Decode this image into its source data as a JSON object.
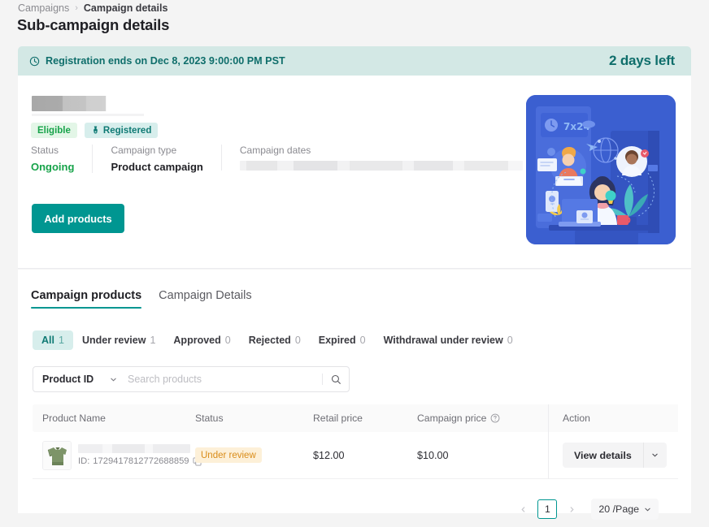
{
  "breadcrumb": {
    "parent": "Campaigns",
    "separator": "›",
    "current": "Campaign details"
  },
  "page_title": "Sub-campaign details",
  "banner": {
    "icon": "clock-icon",
    "message": "Registration ends on Dec 8, 2023 9:00:00 PM PST",
    "countdown": "2 days left",
    "bg_color": "#d3e8e5",
    "text_color": "#0f6e6b"
  },
  "summary": {
    "campaign_name_masked": true,
    "badges": [
      {
        "label": "Eligible",
        "color": "#17a34a",
        "bg": "#e3f6e7",
        "icon": null
      },
      {
        "label": "Registered",
        "color": "#0f7a74",
        "bg": "#d7eeec",
        "icon": "medal-icon"
      }
    ],
    "meta": [
      {
        "label": "Status",
        "value": "Ongoing",
        "highlight": "#17a34a"
      },
      {
        "label": "Campaign type",
        "value": "Product campaign",
        "highlight": null
      },
      {
        "label": "Campaign dates",
        "value": "",
        "masked": true
      }
    ],
    "add_products_label": "Add products",
    "add_products_color": "#009691",
    "illustration": {
      "name": "team-collaboration-illustration",
      "bg_color": "#3b5fd0",
      "screen_text": "7x24"
    }
  },
  "tabs": [
    {
      "label": "Campaign products",
      "active": true
    },
    {
      "label": "Campaign Details",
      "active": false
    }
  ],
  "status_filters": [
    {
      "label": "All",
      "count": "1",
      "active": true
    },
    {
      "label": "Under review",
      "count": "1",
      "active": false
    },
    {
      "label": "Approved",
      "count": "0",
      "active": false
    },
    {
      "label": "Rejected",
      "count": "0",
      "active": false
    },
    {
      "label": "Expired",
      "count": "0",
      "active": false
    },
    {
      "label": "Withdrawal under review",
      "count": "0",
      "active": false
    }
  ],
  "search": {
    "field_selected": "Product ID",
    "placeholder": "Search products",
    "icon": "search-icon"
  },
  "table": {
    "columns": [
      {
        "key": "name",
        "label": "Product Name"
      },
      {
        "key": "status",
        "label": "Status"
      },
      {
        "key": "retail",
        "label": "Retail price"
      },
      {
        "key": "campaign",
        "label": "Campaign price",
        "help_icon": "question-circle-icon"
      },
      {
        "key": "action",
        "label": "Action"
      }
    ],
    "rows": [
      {
        "thumbnail": "green-tshirt-thumbnail",
        "name_masked": true,
        "id_prefix": "ID:",
        "product_id": "1729417812772688859",
        "copy_icon": "copy-icon",
        "status": "Under review",
        "status_color": "#d98c19",
        "status_bg": "#fdf0d8",
        "retail_price": "$12.00",
        "campaign_price": "$10.00",
        "action_label": "View details",
        "action_caret": "chevron-down-icon"
      }
    ]
  },
  "pagination": {
    "prev_icon": "chevron-left-icon",
    "next_icon": "chevron-right-icon",
    "current_page": "1",
    "page_size": "20 /Page",
    "page_size_caret": "chevron-down-icon"
  }
}
